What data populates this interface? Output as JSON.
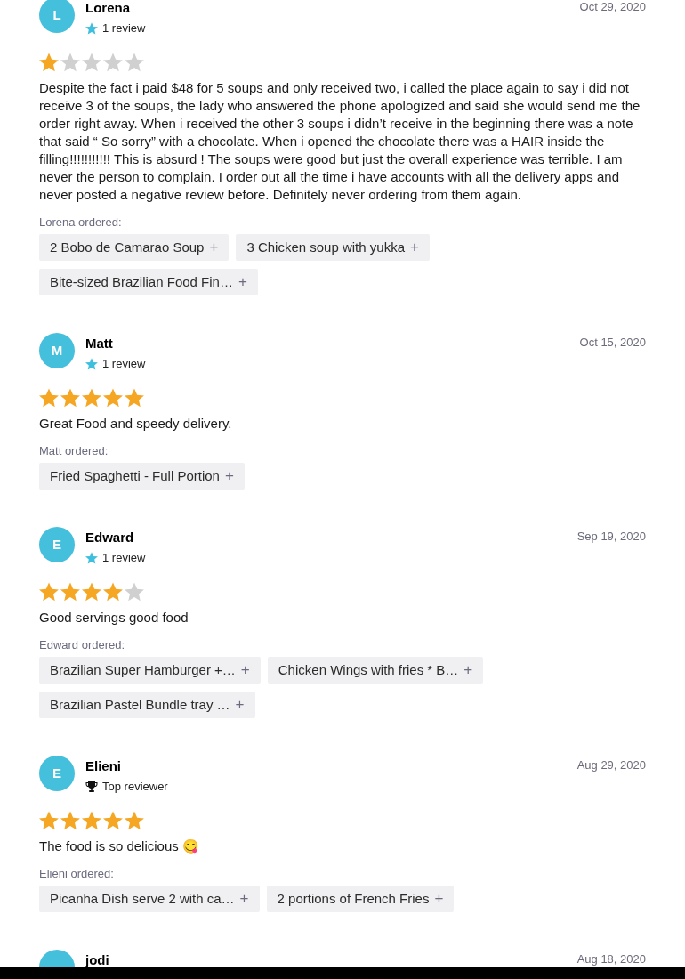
{
  "reviews": [
    {
      "initial": "L",
      "name": "Lorena",
      "badge": {
        "kind": "review_count",
        "text": "1 review"
      },
      "date": "Oct 29, 2020",
      "stars": 1,
      "text": "Despite the fact i paid $48 for 5 soups and only received two, i called the place again to say i did not receive 3 of the soups, the lady who answered the phone apologized and said she would send me the order right away. When i received the other 3 soups i didn’t receive in the beginning there was a note that said “ So sorry” with a chocolate. When i opened the chocolate there was a HAIR inside the filling!!!!!!!!!!! This is absurd ! The soups were good but just the overall experience was terrible. I am never the person to complain. I order out all the time i have accounts with all the delivery apps and never posted a negative review before. Definitely never ordering from them again.",
      "ordered_label": "Lorena ordered:",
      "items": [
        {
          "label": "2 Bobo de Camarao Soup",
          "icon": "+"
        },
        {
          "label": "3 Chicken soup with yukka",
          "icon": "+"
        },
        {
          "label": "Bite-sized Brazilian Food Fin…",
          "icon": "+"
        }
      ]
    },
    {
      "initial": "M",
      "name": "Matt",
      "badge": {
        "kind": "review_count",
        "text": "1 review"
      },
      "date": "Oct 15, 2020",
      "stars": 5,
      "text": "Great Food and speedy delivery.",
      "ordered_label": "Matt ordered:",
      "items": [
        {
          "label": "Fried Spaghetti - Full Portion",
          "icon": "+"
        }
      ]
    },
    {
      "initial": "E",
      "name": "Edward",
      "badge": {
        "kind": "review_count",
        "text": "1 review"
      },
      "date": "Sep 19, 2020",
      "stars": 4,
      "text": "Good servings good food",
      "ordered_label": "Edward ordered:",
      "items": [
        {
          "label": "Brazilian Super Hamburger +…",
          "icon": "+"
        },
        {
          "label": "Chicken Wings with fries * B…",
          "icon": "+"
        },
        {
          "label": "Brazilian Pastel Bundle tray …",
          "icon": "+"
        }
      ]
    },
    {
      "initial": "E",
      "name": "Elieni",
      "badge": {
        "kind": "top_reviewer",
        "text": "Top reviewer"
      },
      "date": "Aug 29, 2020",
      "stars": 5,
      "text": "The food is so delicious 😋",
      "ordered_label": "Elieni ordered:",
      "items": [
        {
          "label": "Picanha Dish serve 2 with ca…",
          "icon": "+"
        },
        {
          "label": "2 portions of French Fries",
          "icon": "+"
        }
      ]
    },
    {
      "name": "jodi",
      "date": "Aug 18, 2020"
    }
  ]
}
